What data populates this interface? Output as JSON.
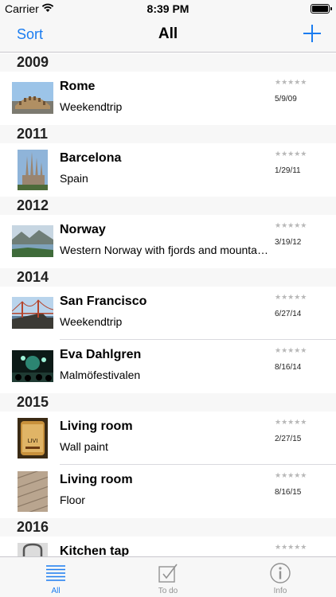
{
  "status_bar": {
    "carrier": "Carrier",
    "time": "8:39 PM"
  },
  "nav": {
    "sort_label": "Sort",
    "title": "All",
    "add_icon": "plus-icon"
  },
  "sections": [
    {
      "year": "2009",
      "items": [
        {
          "title": "Rome",
          "subtitle": "Weekendtrip",
          "date": "5/9/09",
          "rating": "★★★★★",
          "thumb": "colosseum"
        }
      ]
    },
    {
      "year": "2011",
      "items": [
        {
          "title": "Barcelona",
          "subtitle": "Spain",
          "date": "1/29/11",
          "rating": "★★★★★",
          "thumb": "sagrada"
        }
      ]
    },
    {
      "year": "2012",
      "items": [
        {
          "title": "Norway",
          "subtitle": "Western Norway with fjords and mountains",
          "date": "3/19/12",
          "rating": "★★★★★",
          "thumb": "fjord"
        }
      ]
    },
    {
      "year": "2014",
      "items": [
        {
          "title": "San Francisco",
          "subtitle": "Weekendtrip",
          "date": "6/27/14",
          "rating": "★★★★★",
          "thumb": "bridge"
        },
        {
          "title": "Eva Dahlgren",
          "subtitle": "Malmöfestivalen",
          "date": "8/16/14",
          "rating": "★★★★★",
          "thumb": "concert"
        }
      ]
    },
    {
      "year": "2015",
      "items": [
        {
          "title": "Living room",
          "subtitle": "Wall paint",
          "date": "2/27/15",
          "rating": "★★★★★",
          "thumb": "paint"
        },
        {
          "title": "Living room",
          "subtitle": "Floor",
          "date": "8/16/15",
          "rating": "★★★★★",
          "thumb": "floor"
        }
      ]
    },
    {
      "year": "2016",
      "items": [
        {
          "title": "Kitchen tap",
          "subtitle": "",
          "date": "",
          "rating": "★★★★★",
          "thumb": "tap"
        }
      ]
    }
  ],
  "tabs": [
    {
      "label": "All",
      "icon": "list-icon",
      "active": true
    },
    {
      "label": "To do",
      "icon": "checkbox-icon",
      "active": false
    },
    {
      "label": "Info",
      "icon": "info-icon",
      "active": false
    }
  ],
  "colors": {
    "accent": "#1a7cf0",
    "header_bg": "#f7f7f7",
    "inactive": "#929292"
  }
}
